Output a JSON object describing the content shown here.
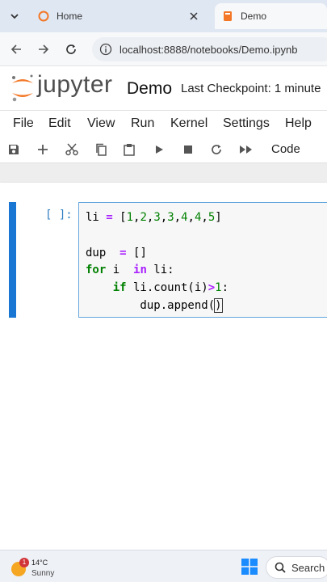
{
  "browser": {
    "tabs": [
      {
        "label": "Home",
        "icon": "jupyter-favicon"
      },
      {
        "label": "Demo",
        "icon": "notebook-favicon"
      }
    ],
    "url": "localhost:8888/notebooks/Demo.ipynb"
  },
  "header": {
    "logo_text": "jupyter",
    "notebook_title": "Demo",
    "checkpoint": "Last Checkpoint: 1 minute"
  },
  "menu": [
    "File",
    "Edit",
    "View",
    "Run",
    "Kernel",
    "Settings",
    "Help"
  ],
  "toolbar": {
    "icons": [
      "save-icon",
      "add-icon",
      "cut-icon",
      "copy-icon",
      "paste-icon",
      "run-icon",
      "stop-icon",
      "restart-icon",
      "run-all-icon"
    ],
    "cell_type": "Code"
  },
  "cell": {
    "prompt": "[ ]:",
    "lines": [
      "li = [1,2,3,3,4,4,5]",
      "",
      "dup  = []",
      "for i  in li:",
      "    if li.count(i)>1:",
      "        dup.append()"
    ]
  },
  "taskbar": {
    "weather_temp": "14°C",
    "weather_condition": "Sunny",
    "weather_badge": "1",
    "search_label": "Search"
  },
  "colors": {
    "accent": "#1976d2",
    "jupyter_orange": "#f37726",
    "keyword_green": "#008000",
    "operator_purple": "#aa22ff"
  }
}
